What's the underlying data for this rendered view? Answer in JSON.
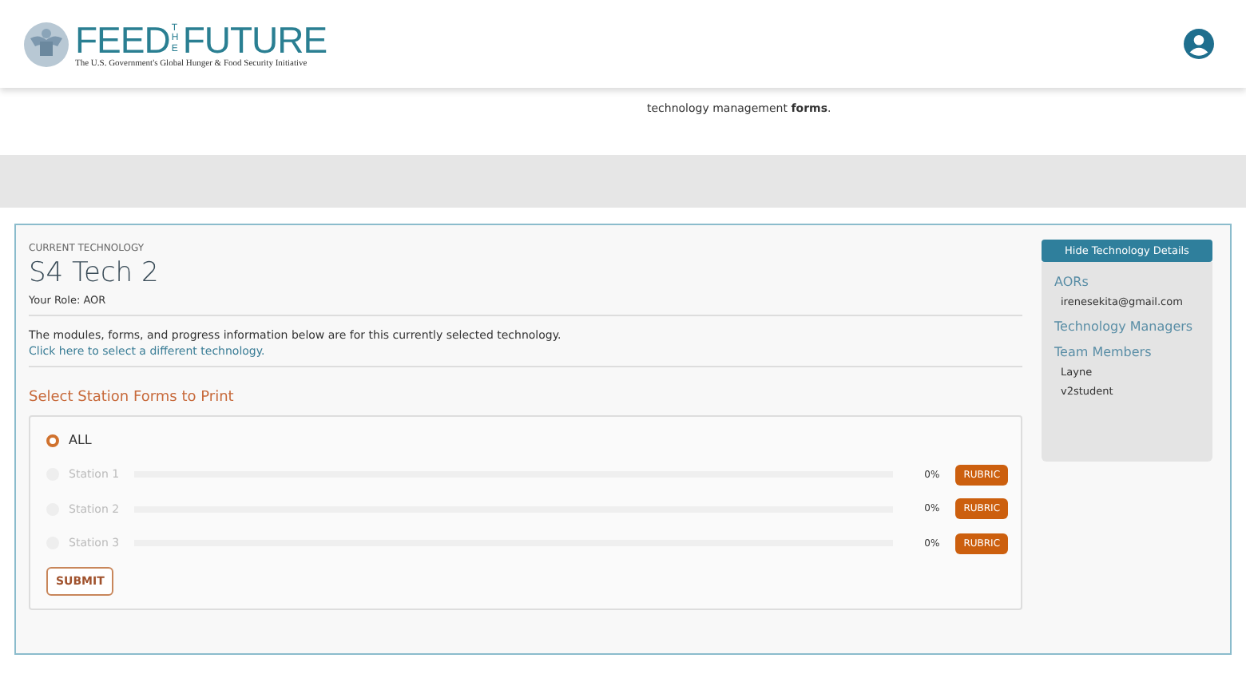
{
  "header": {
    "logo": {
      "word_1": "FEED",
      "word_2": "THE",
      "word_3": "FUTURE",
      "tagline": "The U.S. Government's Global Hunger & Food Security Initiative"
    }
  },
  "intro": {
    "text": "technology management **forms**."
  },
  "technology": {
    "eyebrow": "CURRENT TECHNOLOGY",
    "name": "S4 Tech 2",
    "role": "Your Role: AOR",
    "description": "The modules, forms, and progress information below are for this currently selected technology.",
    "change_link": "Click here to select a different technology."
  },
  "print_form": {
    "heading": "Select Station Forms to Print",
    "all_option": {
      "label": "ALL",
      "selected": true
    },
    "stations": [
      {
        "label": "Station 1",
        "selected": false,
        "disabled": true,
        "level": 0,
        "percent": "0%",
        "rubric": "RUBRIC"
      },
      {
        "label": "Station 2",
        "selected": false,
        "disabled": true,
        "level": 0,
        "percent": "0%",
        "rubric": "RUBRIC"
      },
      {
        "label": "Station 3",
        "selected": false,
        "disabled": true,
        "level": 0,
        "percent": "0%",
        "rubric": "RUBRIC"
      }
    ],
    "submit": "SUBMIT"
  },
  "details": {
    "toggle": "Hide Technology Details",
    "sections": [
      {
        "heading": "AORs",
        "entries": [
          "irenesekita@gmail.com"
        ]
      },
      {
        "heading": "Technology Managers"
      },
      {
        "heading": "Team Members",
        "entries": [
          "Layne",
          "v2student"
        ]
      }
    ]
  }
}
